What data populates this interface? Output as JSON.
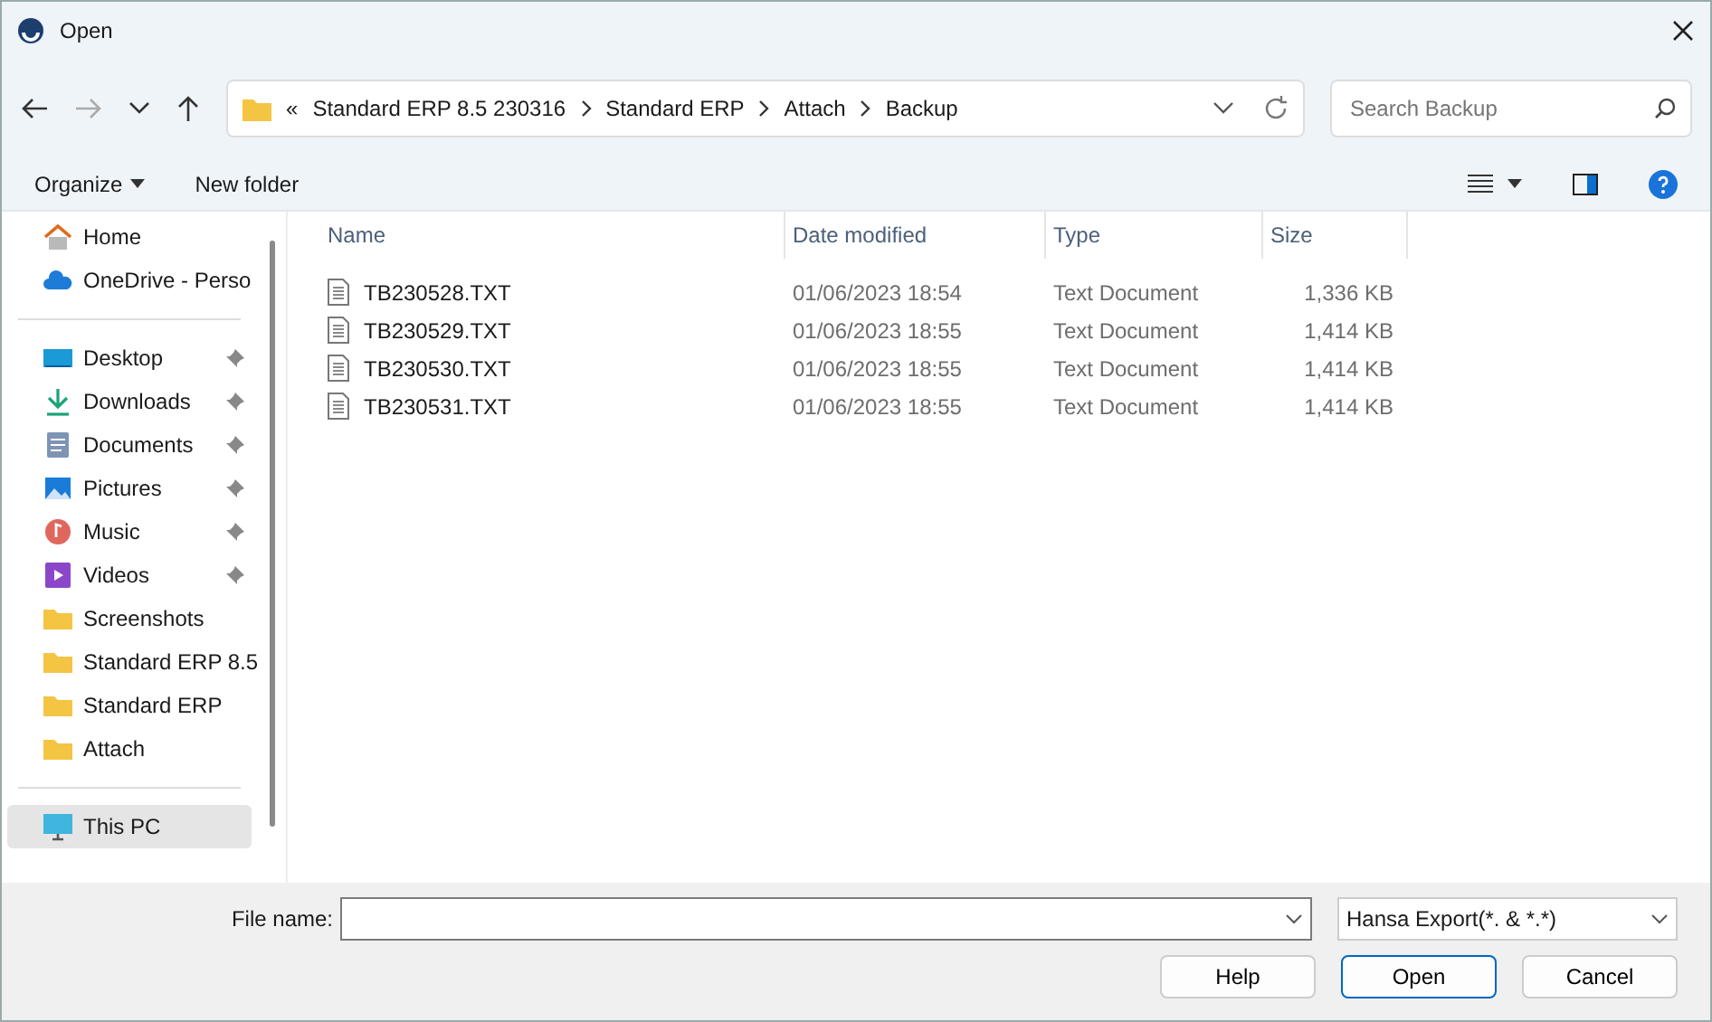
{
  "window": {
    "title": "Open"
  },
  "address": {
    "overflow": "«",
    "crumbs": [
      "Standard ERP 8.5 230316",
      "Standard ERP",
      "Attach",
      "Backup"
    ]
  },
  "search": {
    "placeholder": "Search Backup"
  },
  "toolbar": {
    "organize": "Organize",
    "new_folder": "New folder"
  },
  "sidebar": {
    "sections": [
      [
        {
          "label": "Home",
          "kind": "home",
          "pinned": false,
          "selected": false
        },
        {
          "label": "OneDrive - Perso",
          "kind": "cloud",
          "pinned": false,
          "selected": false
        }
      ],
      [
        {
          "label": "Desktop",
          "kind": "desktop",
          "pinned": true,
          "selected": false
        },
        {
          "label": "Downloads",
          "kind": "download",
          "pinned": true,
          "selected": false
        },
        {
          "label": "Documents",
          "kind": "document",
          "pinned": true,
          "selected": false
        },
        {
          "label": "Pictures",
          "kind": "picture",
          "pinned": true,
          "selected": false
        },
        {
          "label": "Music",
          "kind": "music",
          "pinned": true,
          "selected": false
        },
        {
          "label": "Videos",
          "kind": "video",
          "pinned": true,
          "selected": false
        },
        {
          "label": "Screenshots",
          "kind": "folder",
          "pinned": false,
          "selected": false
        },
        {
          "label": "Standard ERP 8.5",
          "kind": "folder",
          "pinned": false,
          "selected": false
        },
        {
          "label": "Standard ERP",
          "kind": "folder",
          "pinned": false,
          "selected": false
        },
        {
          "label": "Attach",
          "kind": "folder",
          "pinned": false,
          "selected": false
        }
      ],
      [
        {
          "label": "This PC",
          "kind": "pc",
          "pinned": false,
          "selected": true
        }
      ]
    ]
  },
  "table": {
    "columns": [
      "Name",
      "Date modified",
      "Type",
      "Size"
    ],
    "rows": [
      {
        "name": "TB230528.TXT",
        "date": "01/06/2023 18:54",
        "type": "Text Document",
        "size": "1,336 KB"
      },
      {
        "name": "TB230529.TXT",
        "date": "01/06/2023 18:55",
        "type": "Text Document",
        "size": "1,414 KB"
      },
      {
        "name": "TB230530.TXT",
        "date": "01/06/2023 18:55",
        "type": "Text Document",
        "size": "1,414 KB"
      },
      {
        "name": "TB230531.TXT",
        "date": "01/06/2023 18:55",
        "type": "Text Document",
        "size": "1,414 KB"
      }
    ]
  },
  "footer": {
    "file_name_label": "File name:",
    "file_type": "Hansa Export(*. & *.*)",
    "buttons": [
      "Help",
      "Open",
      "Cancel"
    ]
  }
}
